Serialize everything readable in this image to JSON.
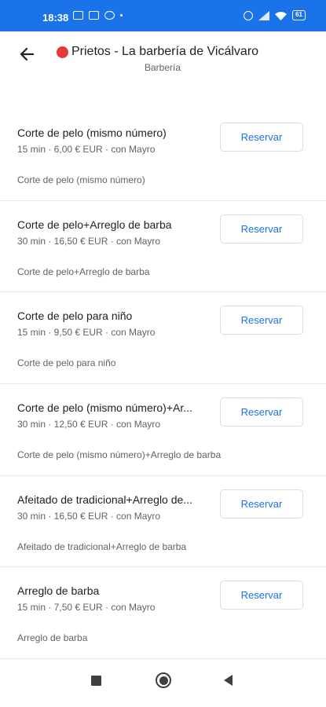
{
  "status": {
    "time": "18:38",
    "battery": "61"
  },
  "header": {
    "title": "Prietos - La barbería de Vicálvaro",
    "subtitle": "Barbería"
  },
  "services": [
    {
      "name": "Corte de pelo (mismo número)",
      "meta": "15 min · 6,00 € EUR · con Mayro",
      "description": "Corte de pelo (mismo número)",
      "button": "Reservar"
    },
    {
      "name": "Corte de pelo+Arreglo de barba",
      "meta": "30 min · 16,50 € EUR · con Mayro",
      "description": "Corte de pelo+Arreglo de barba",
      "button": "Reservar"
    },
    {
      "name": "Corte de pelo para niño",
      "meta": "15 min · 9,50 € EUR · con Mayro",
      "description": "Corte de pelo para niño",
      "button": "Reservar"
    },
    {
      "name": "Corte de pelo (mismo número)+Ar...",
      "meta": "30 min · 12,50 € EUR · con Mayro",
      "description": "Corte de pelo (mismo número)+Arreglo de barba",
      "button": "Reservar"
    },
    {
      "name": "Afeitado de tradicional+Arreglo de...",
      "meta": "30 min · 16,50 € EUR · con Mayro",
      "description": "Afeitado de tradicional+Arreglo de barba",
      "button": "Reservar"
    },
    {
      "name": "Arreglo de barba",
      "meta": "15 min · 7,50 € EUR · con Mayro",
      "description": "Arreglo de barba",
      "button": "Reservar"
    }
  ],
  "colors": {
    "accent": "#1a73e8",
    "status_dot": "#e53935"
  },
  "icons": {
    "back": "arrow-back-icon",
    "nav_recents": "square-icon",
    "nav_home": "circle-icon",
    "nav_back": "triangle-back-icon"
  }
}
